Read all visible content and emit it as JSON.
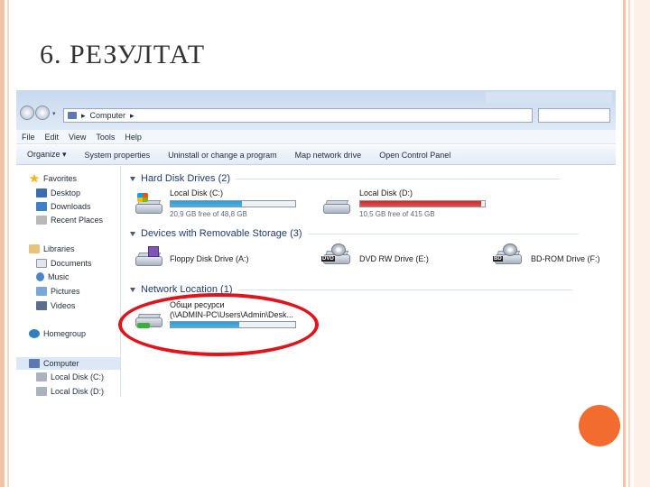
{
  "slide": {
    "title": "6. РЕЗУЛТАТ"
  },
  "explorer": {
    "address": {
      "path": "Computer"
    },
    "menu": [
      "File",
      "Edit",
      "View",
      "Tools",
      "Help"
    ],
    "toolbar": [
      "Organize ▾",
      "System properties",
      "Uninstall or change a program",
      "Map network drive",
      "Open Control Panel"
    ],
    "nav": {
      "favorites": "Favorites",
      "desktop": "Desktop",
      "downloads": "Downloads",
      "recent_places": "Recent Places",
      "libraries": "Libraries",
      "documents": "Documents",
      "music": "Music",
      "pictures": "Pictures",
      "videos": "Videos",
      "homegroup": "Homegroup",
      "computer": "Computer",
      "local_c": "Local Disk (C:)",
      "local_d": "Local Disk (D:)"
    },
    "groups": {
      "hard_disks": "Hard Disk Drives (2)",
      "removable": "Devices with Removable Storage (3)",
      "network": "Network Location (1)"
    },
    "drives": {
      "c": {
        "name": "Local Disk (C:)",
        "free": "20,9 GB free of 48,8 GB",
        "used_fraction": 0.57,
        "bar_color": "#26a0da"
      },
      "d": {
        "name": "Local Disk (D:)",
        "free": "10,5 GB free of 415 GB",
        "used_fraction": 0.97,
        "bar_color": "#da2626"
      },
      "floppy": {
        "name": "Floppy Disk Drive (A:)"
      },
      "dvd": {
        "name": "DVD RW Drive (E:)",
        "badge": "DVD"
      },
      "bd": {
        "name": "BD-ROM Drive (F:)",
        "badge": "BD"
      },
      "net": {
        "name": "Общи ресурси",
        "path": "(\\\\ADMIN-PC\\Users\\Admin\\Desk...",
        "used_fraction": 0.55,
        "bar_color": "#26a0da"
      }
    }
  },
  "colors": {
    "highlight_ellipse": "#e0141c",
    "accent_dot": "#f26b2f"
  }
}
